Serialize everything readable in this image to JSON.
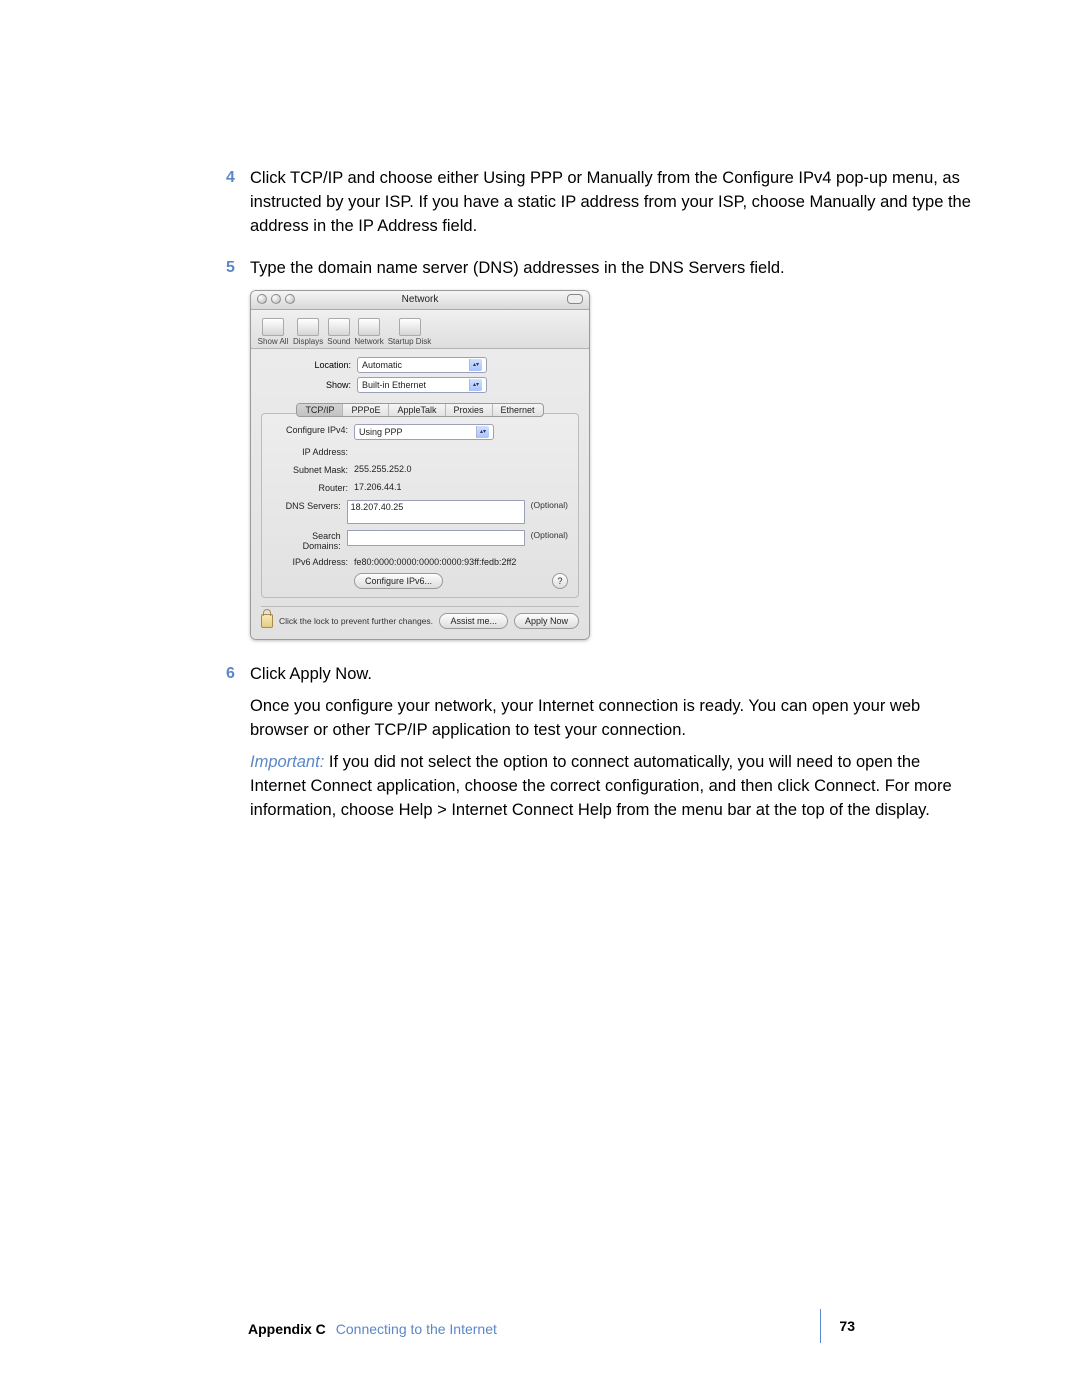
{
  "steps": {
    "s4": {
      "num": "4",
      "text": "Click TCP/IP and choose either Using PPP or Manually from the Configure IPv4 pop-up menu, as instructed by your ISP. If you have a static IP address from your ISP, choose Manually and type the address in the IP Address field."
    },
    "s5": {
      "num": "5",
      "text": "Type the domain name server (DNS) addresses in the DNS Servers field."
    },
    "s6": {
      "num": "6",
      "text": "Click Apply Now.",
      "p2": "Once you configure your network, your Internet connection is ready. You can open your web browser or other TCP/IP application to test your connection.",
      "imp_label": "Important:",
      "imp_rest": "  If you did not select the option to connect automatically, you will need to open the Internet Connect application, choose the correct configuration, and then click Connect. For more information, choose Help > Internet Connect Help from the menu bar at the top of the display."
    }
  },
  "window": {
    "title": "Network",
    "toolbar": {
      "showall": "Show All",
      "displays": "Displays",
      "sound": "Sound",
      "network": "Network",
      "startup": "Startup Disk"
    },
    "location_lbl": "Location:",
    "location_val": "Automatic",
    "show_lbl": "Show:",
    "show_val": "Built-in Ethernet",
    "tabs": {
      "tcpip": "TCP/IP",
      "pppoe": "PPPoE",
      "appletalk": "AppleTalk",
      "proxies": "Proxies",
      "ethernet": "Ethernet"
    },
    "cfg4_lbl": "Configure IPv4:",
    "cfg4_val": "Using PPP",
    "ip_lbl": "IP Address:",
    "ip_val": "",
    "subnet_lbl": "Subnet Mask:",
    "subnet_val": "255.255.252.0",
    "router_lbl": "Router:",
    "router_val": "17.206.44.1",
    "dns_lbl": "DNS Servers:",
    "dns_val": "18.207.40.25",
    "dns_opt": "(Optional)",
    "search_lbl": "Search Domains:",
    "search_val": "",
    "search_opt": "(Optional)",
    "ipv6_lbl": "IPv6 Address:",
    "ipv6_val": "fe80:0000:0000:0000:0000:93ff:fedb:2ff2",
    "cfg6_btn": "Configure IPv6...",
    "help": "?",
    "lock_text": "Click the lock to prevent further changes.",
    "assist_btn": "Assist me...",
    "apply_btn": "Apply Now"
  },
  "footer": {
    "appendix": "Appendix C",
    "title": "Connecting to the Internet",
    "page": "73"
  }
}
